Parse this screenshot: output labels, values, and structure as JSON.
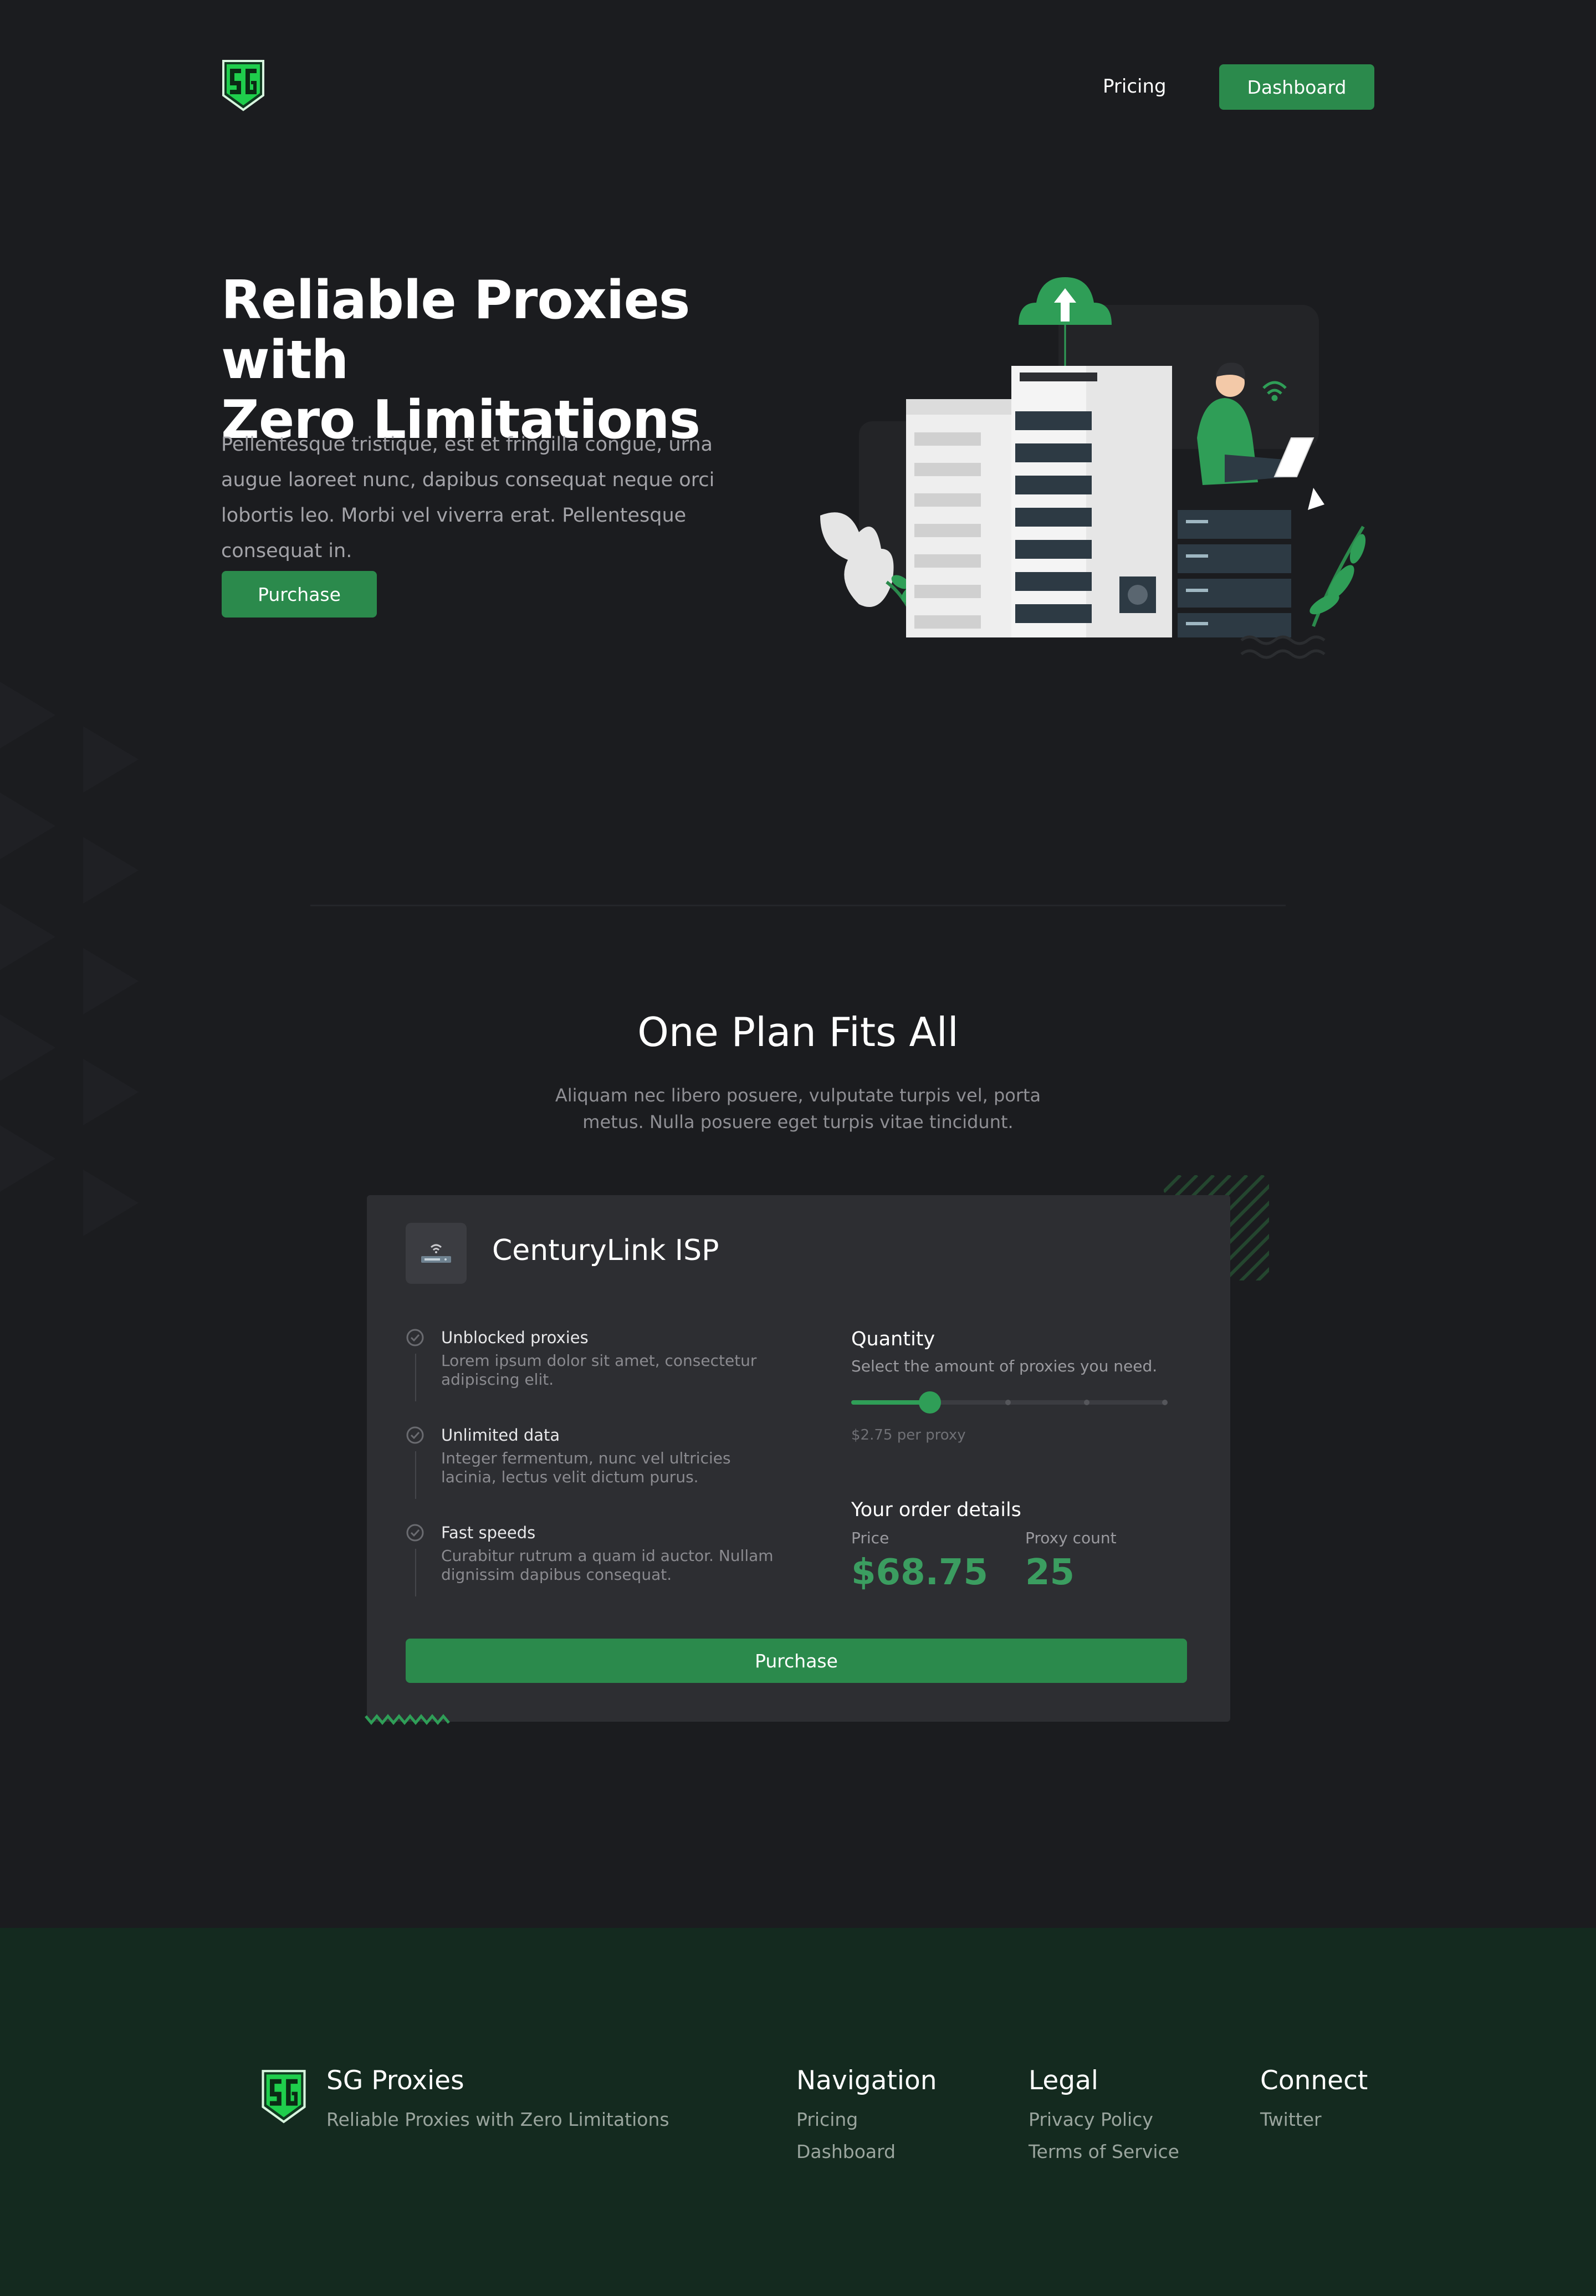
{
  "nav": {
    "logo_icon": "sg-shield-logo-icon",
    "pricing_label": "Pricing",
    "dashboard_label": "Dashboard"
  },
  "hero": {
    "title_line1": "Reliable Proxies with",
    "title_line2": "Zero Limitations",
    "description": "Pellentesque tristique, est et fringilla congue, urna augue laoreet nunc, dapibus consequat neque orci lobortis leo. Morbi vel viverra erat. Pellentesque consequat in.",
    "purchase_label": "Purchase",
    "illustration_icon": "server-rack-developer-illustration"
  },
  "plan": {
    "title": "One Plan Fits All",
    "subtitle": "Aliquam nec libero posuere, vulputate turpis vel, porta metus. Nulla posuere eget turpis vitae tincidunt.",
    "card": {
      "isp_icon": "router-icon",
      "isp_name": "CenturyLink ISP",
      "features": [
        {
          "title": "Unblocked proxies",
          "description": "Lorem ipsum dolor sit amet, consectetur adipiscing elit.",
          "icon": "check-circle-icon"
        },
        {
          "title": "Unlimited data",
          "description": "Integer fermentum, nunc vel ultricies lacinia, lectus velit dictum purus.",
          "icon": "check-circle-icon"
        },
        {
          "title": "Fast speeds",
          "description": "Curabitur rutrum a quam id auctor. Nullam dignissim dapibus consequat.",
          "icon": "check-circle-icon"
        }
      ],
      "quantity": {
        "title": "Quantity",
        "subtitle": "Select the amount of proxies you need.",
        "slider_fraction": 0.25,
        "slider_steps": 5,
        "per_proxy": "$2.75 per proxy"
      },
      "order": {
        "title": "Your order details",
        "price_label": "Price",
        "price_value": "$68.75",
        "count_label": "Proxy count",
        "count_value": "25"
      },
      "purchase_label": "Purchase"
    }
  },
  "footer": {
    "brand": "SG Proxies",
    "tagline": "Reliable Proxies with Zero Limitations",
    "navigation": {
      "heading": "Navigation",
      "links": [
        "Pricing",
        "Dashboard"
      ]
    },
    "legal": {
      "heading": "Legal",
      "links": [
        "Privacy Policy",
        "Terms of Service"
      ]
    },
    "connect": {
      "heading": "Connect",
      "links": [
        "Twitter"
      ]
    }
  },
  "colors": {
    "background": "#1b1c1f",
    "accent": "#2b8a4c",
    "accent_bright": "#2f9e57",
    "card": "#2d2e32",
    "footer": "#142a1f"
  }
}
